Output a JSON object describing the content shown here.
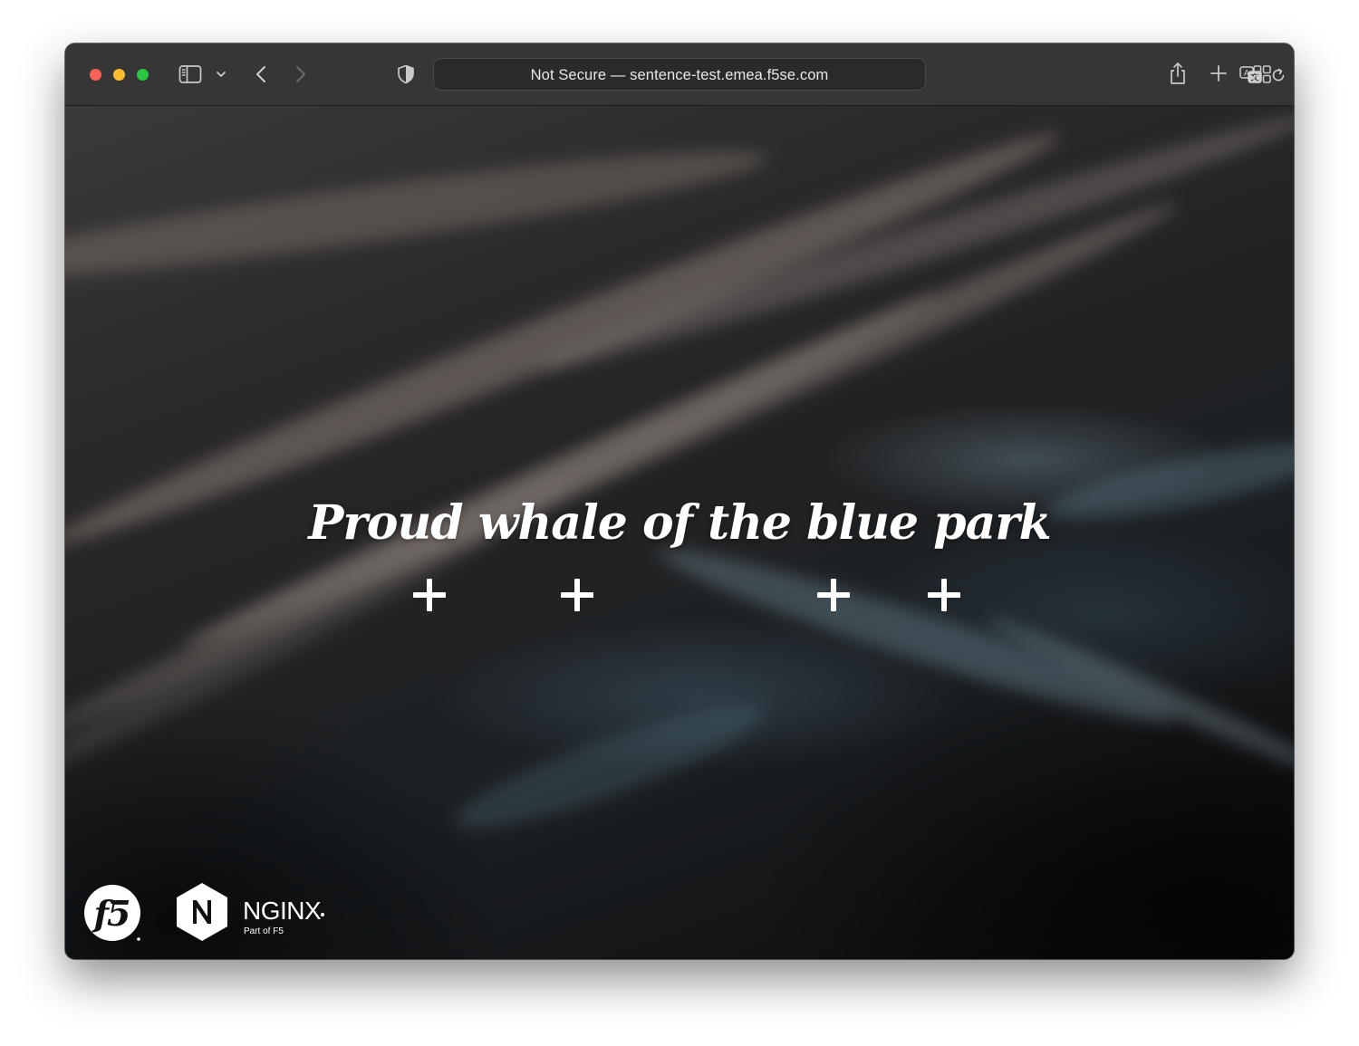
{
  "browser": {
    "address": {
      "security_label": "Not Secure",
      "separator": " — ",
      "url": "sentence-test.emea.f5se.com"
    },
    "icons": {
      "close": "close-window-dot",
      "minimize": "minimize-window-dot",
      "maximize": "maximize-window-dot",
      "sidebar": "sidebar-icon",
      "sidebar_menu": "chevron-down-icon",
      "back": "chevron-left-icon",
      "forward": "chevron-right-icon",
      "privacy": "shield-icon",
      "translate": "translate-icon",
      "reload": "reload-icon",
      "share": "share-icon",
      "new_tab": "plus-icon",
      "tab_overview": "grid-icon"
    },
    "colors": {
      "close": "#fe5f57",
      "minimize": "#febc2e",
      "maximize": "#28c840",
      "toolbar": "#363636"
    }
  },
  "page": {
    "headline": "Proud whale of the blue park",
    "plus_buttons": [
      "plus-icon",
      "plus-icon",
      "plus-icon",
      "plus-icon"
    ],
    "logos": {
      "f5": "f5",
      "nginx_mark": "N",
      "nginx_name": "NGINX",
      "nginx_tagline": "Part of F5"
    }
  }
}
